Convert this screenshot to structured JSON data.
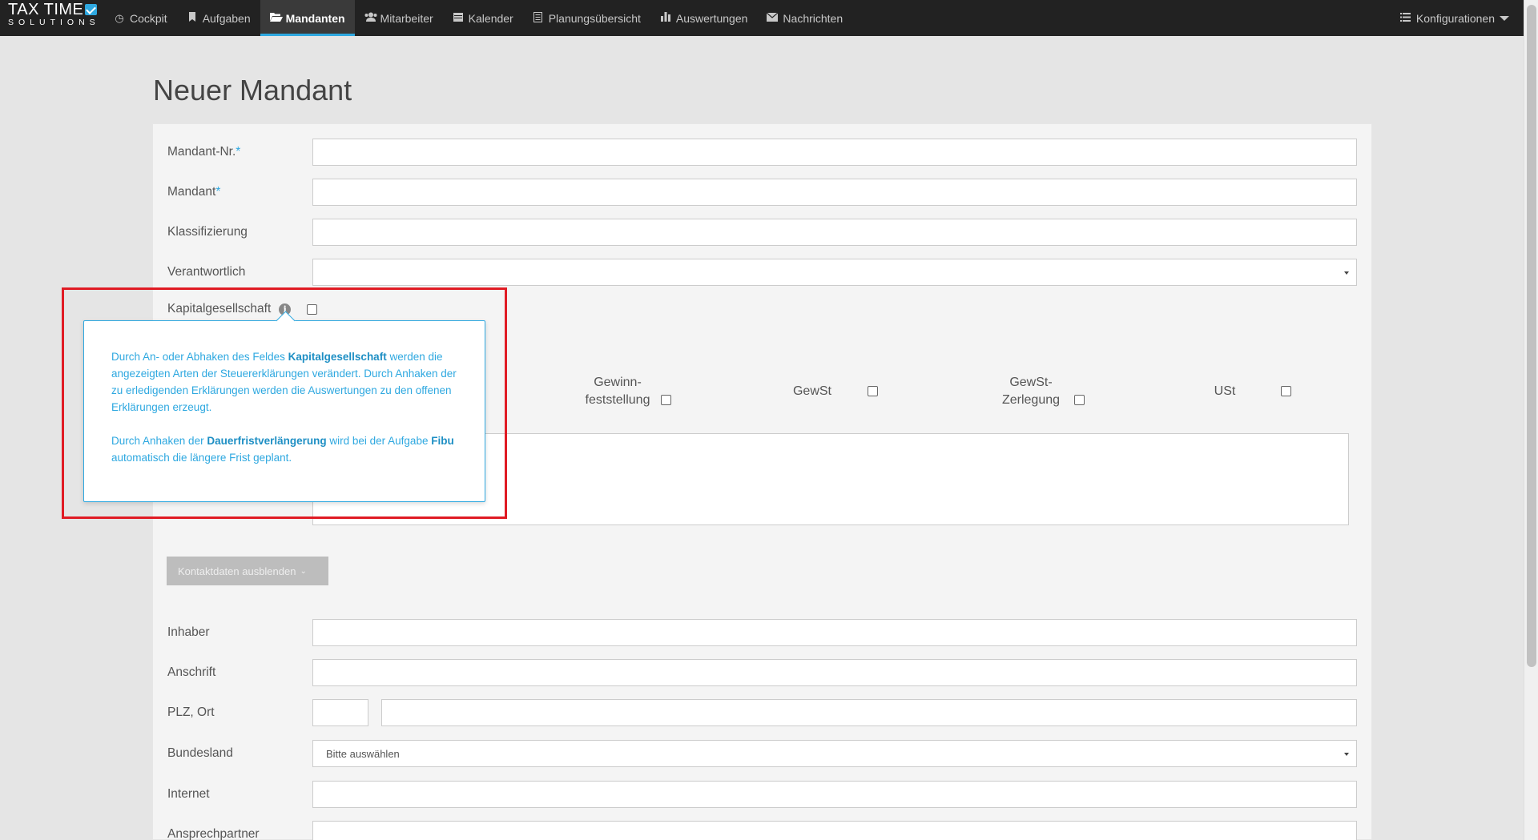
{
  "nav": {
    "logo_top": "TAX TIME",
    "logo_bottom": "SOLUTIONS",
    "items": [
      {
        "label": "Cockpit",
        "icon": "clock-icon"
      },
      {
        "label": "Aufgaben",
        "icon": "bookmark-icon"
      },
      {
        "label": "Mandanten",
        "icon": "folder-open-icon",
        "active": true
      },
      {
        "label": "Mitarbeiter",
        "icon": "users-icon"
      },
      {
        "label": "Kalender",
        "icon": "calendar-icon"
      },
      {
        "label": "Planungsübersicht",
        "icon": "list-document-icon"
      },
      {
        "label": "Auswertungen",
        "icon": "bar-chart-icon"
      },
      {
        "label": "Nachrichten",
        "icon": "envelope-icon"
      }
    ],
    "config_label": "Konfigurationen"
  },
  "page": {
    "title": "Neuer Mandant"
  },
  "form": {
    "mandant_nr_label": "Mandant-Nr.",
    "mandant_label": "Mandant",
    "required_marker": "*",
    "klassifizierung_label": "Klassifizierung",
    "verantwortlich_label": "Verantwortlich",
    "verantwortlich_value": "",
    "kapitalgesellschaft_label": "Kapitalgesellschaft",
    "tax_types": [
      {
        "label_line1": "Gewinn-",
        "label_line2": "feststellung"
      },
      {
        "label_line1": "GewSt",
        "label_line2": ""
      },
      {
        "label_line1": "GewSt-",
        "label_line2": "Zerlegung"
      },
      {
        "label_line1": "USt",
        "label_line2": ""
      }
    ],
    "toggle_contact_label": "Kontaktdaten ausblenden",
    "inhaber_label": "Inhaber",
    "anschrift_label": "Anschrift",
    "plz_ort_label": "PLZ, Ort",
    "bundesland_label": "Bundesland",
    "bundesland_value": "Bitte auswählen",
    "internet_label": "Internet",
    "ansprechpartner_label": "Ansprechpartner"
  },
  "popover": {
    "p1_a": "Durch An- oder Abhaken des Feldes ",
    "p1_b": "Kapitalgesellschaft",
    "p1_c": " werden die angezeigten Arten der Steuererklärungen verändert. Durch Anhaken der zu erledigenden Erklärungen werden die Auswertungen zu den offenen Erklärungen erzeugt.",
    "p2_a": "Durch Anhaken der ",
    "p2_b": "Dauerfristverlängerung",
    "p2_c": " wird bei der Aufgabe ",
    "p2_d": "Fibu",
    "p2_e": " automatisch die längere Frist geplant."
  },
  "colors": {
    "navbar": "#222222",
    "accent": "#2ea8e0",
    "highlight": "#e01b24"
  }
}
